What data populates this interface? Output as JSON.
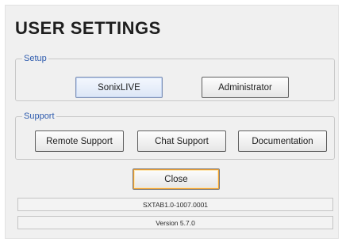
{
  "dialog": {
    "title": "USER SETTINGS",
    "setup": {
      "legend": "Setup",
      "sonixlive_label": "SonixLIVE",
      "administrator_label": "Administrator"
    },
    "support": {
      "legend": "Support",
      "remote_support_label": "Remote Support",
      "chat_support_label": "Chat Support",
      "documentation_label": "Documentation"
    },
    "close_label": "Close",
    "build_id": "SXTAB1.0-1007.0001",
    "version": "Version 5.7.0"
  },
  "colors": {
    "legend_text": "#2f5cae",
    "close_focus_ring": "#f0a030"
  }
}
